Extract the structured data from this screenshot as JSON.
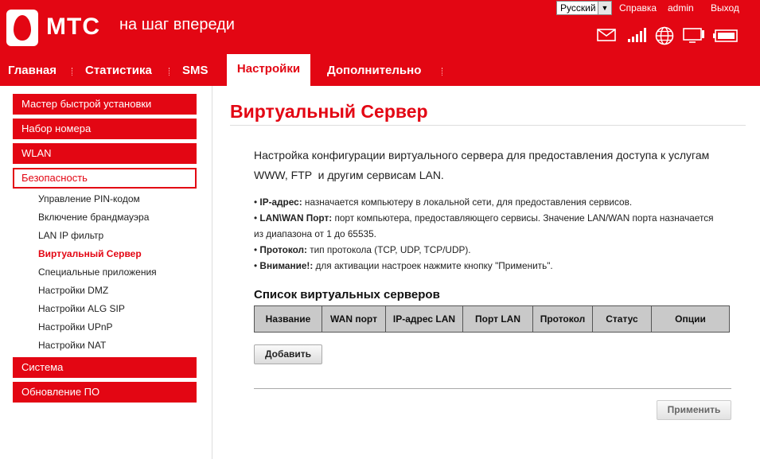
{
  "header": {
    "brand": "МТС",
    "slogan": "на шаг впереди",
    "language": "Русский",
    "links": [
      "Справка",
      "admin",
      "Выход"
    ],
    "icons": [
      "mail-icon",
      "signal-icon",
      "globe-icon",
      "monitor-icon",
      "battery-icon"
    ]
  },
  "nav": {
    "items": [
      "Главная",
      "Статистика",
      "SMS",
      "Настройки",
      "Дополнительно"
    ],
    "active": "Настройки"
  },
  "sidebar": {
    "sections": [
      "Мастер быстрой установки",
      "Набор номера",
      "WLAN",
      "Безопасность",
      "Система",
      "Обновление ПО"
    ],
    "security_items": [
      "Управление PIN-кодом",
      "Включение брандмауэра",
      "LAN IP фильтр",
      "Виртуальный Сервер",
      "Специальные приложения",
      "Настройки DMZ",
      "Настройки ALG SIP",
      "Настройки UPnP",
      "Настройки NAT"
    ],
    "active_item": "Виртуальный Сервер"
  },
  "main": {
    "title": "Виртуальный Сервер",
    "intro_line1": "Настройка конфигурации виртуального сервера для предоставления доступа к услугам",
    "intro_line2": "WWW, FTP  и другим сервисам LAN.",
    "notes": [
      {
        "label": "IP-адрес:",
        "text": " назначается компьютеру в локальной сети, для предоставления сервисов."
      },
      {
        "label": "LAN\\WAN Порт:",
        "text": " порт компьютера, предоставляющего сервисы. Значение LAN/WAN порта назначается"
      },
      {
        "label": "",
        "text": "из диапазона от 1 до 65535."
      },
      {
        "label": "Протокол:",
        "text": " тип протокола (TCP, UDP, TCP/UDP)."
      },
      {
        "label": "Внимание!:",
        "text": " для активации настроек нажмите кнопку \"Применить\"."
      }
    ],
    "table_title": "Список виртуальных серверов",
    "columns": [
      "Название",
      "WAN порт",
      "IP-адрес LAN",
      "Порт LAN",
      "Протокол",
      "Статус",
      "Опции"
    ],
    "add_button": "Добавить",
    "apply_button": "Применить"
  },
  "colors": {
    "brand_red": "#e30613",
    "table_header": "#c9c9c9"
  }
}
